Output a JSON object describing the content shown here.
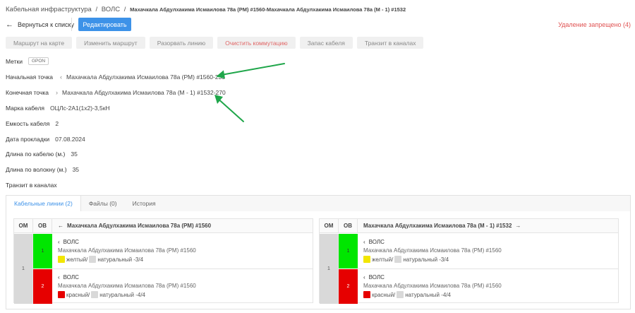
{
  "breadcrumb": {
    "root": "Кабельная инфраструктура",
    "section": "ВОЛС",
    "current": "Махачкала Абдулхакима Исмаилова 78а (РМ) #1560-Махачкала Абдулхакима Исмаилова 78а (М - 1) #1532"
  },
  "header": {
    "back_label": "Вернуться к списку",
    "edit_label": "Редактировать",
    "delete_denied": "Удаление запрещено (4)"
  },
  "toolbar": [
    "Маршрут на карте",
    "Изменить маршрут",
    "Разорвать линию",
    "Очистить коммутацию",
    "Запас кабеля",
    "Транзит в каналах"
  ],
  "fields": {
    "tags_label": "Метки",
    "tag": "GPON",
    "start_label": "Начальная точка",
    "start_value": "Махачкала Абдулхакима Исмаилова 78а (РМ) #1560-235",
    "end_label": "Конечная точка",
    "end_value": "Махачкала Абдулхакима Исмаилова 78а (М - 1) #1532-270",
    "brand_label": "Марка кабеля",
    "brand_value": "ОЦЛс-2А1(1х2)-3,5кН",
    "capacity_label": "Емкость кабеля",
    "capacity_value": "2",
    "date_label": "Дата прокладки",
    "date_value": "07.08.2024",
    "len_cable_label": "Длина по кабелю (м.)",
    "len_cable_value": "35",
    "len_fiber_label": "Длина по волокну (м.)",
    "len_fiber_value": "35",
    "transit_label": "Транзит в каналах"
  },
  "tabs": [
    "Кабельные линии (2)",
    "Файлы (0)",
    "История"
  ],
  "tables": {
    "om_header": "ОМ",
    "ov_header": "ОВ",
    "left_title": "Махачкала Абдулхакима Исмаилова 78а (РМ) #1560",
    "right_title": "Махачкала Абдулхакима Исмаилова 78а (М - 1) #1532",
    "om_value": "1",
    "left_rows": [
      {
        "ov": "1",
        "type": "ВОЛС",
        "place": "Махачкала Абдулхакима Исмаилова 78а (РМ) #1560",
        "color1": "желтый/",
        "color2": "натуральный -3/4"
      },
      {
        "ov": "2",
        "type": "ВОЛС",
        "place": "Махачкала Абдулхакима Исмаилова 78а (РМ) #1560",
        "color1": "красный/",
        "color2": "натуральный -4/4"
      }
    ],
    "right_rows": [
      {
        "ov": "1",
        "type": "ВОЛС",
        "place": "Махачкала Абдулхакима Исмаилова 78а (РМ) #1560",
        "color1": "желтый/",
        "color2": "натуральный -3/4"
      },
      {
        "ov": "2",
        "type": "ВОЛС",
        "place": "Махачкала Абдулхакима Исмаилова 78а (РМ) #1560",
        "color1": "красный/",
        "color2": "натуральный -4/4"
      }
    ]
  },
  "colors": {
    "accent": "#3d92e8",
    "danger": "#e05252",
    "fiber1": "#00e600",
    "fiber2": "#e60000",
    "yellow": "#f2e600",
    "red": "#e60000",
    "natural": "#d9d9d9",
    "annotation": "#1fa64a"
  }
}
